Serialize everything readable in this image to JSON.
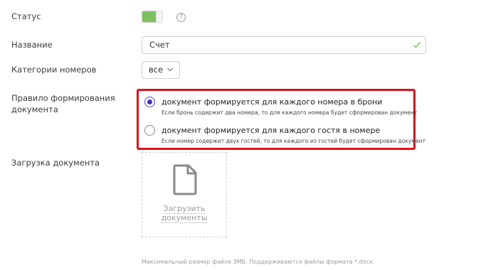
{
  "form": {
    "status_label": "Статус",
    "status_on": true,
    "help_glyph": "?",
    "name_label": "Название",
    "name_value": "Счет",
    "category_label": "Категории номеров",
    "category_value": "все",
    "rule_label": "Правило формирования документа",
    "rule_options": [
      {
        "title": "документ формируется для каждого номера в брони",
        "hint": "Если бронь содержит два номера, то для каждого номера будет сформирован документ",
        "selected": true
      },
      {
        "title": "документ формируется для каждого гостя в номере",
        "hint": "Если номер содержит двух гостей, то для каждого из гостей будет сформирован документ",
        "selected": false
      }
    ],
    "upload_label": "Загрузка документа",
    "upload_button_line1": "Загрузить",
    "upload_button_line2": "документы",
    "upload_note": "Максимальный размер файла 3МБ. Поддерживаются файлы формата *.docx."
  },
  "colors": {
    "toggle_on": "#7cc062",
    "radio_selected": "#4a2fc0",
    "highlight_border": "#e0101a",
    "valid_check": "#7cc062"
  },
  "icons": {
    "status": "toggle-switch",
    "help": "question-circle-icon",
    "valid": "checkmark-icon",
    "select": "chevron-down-icon",
    "upload": "file-icon"
  }
}
